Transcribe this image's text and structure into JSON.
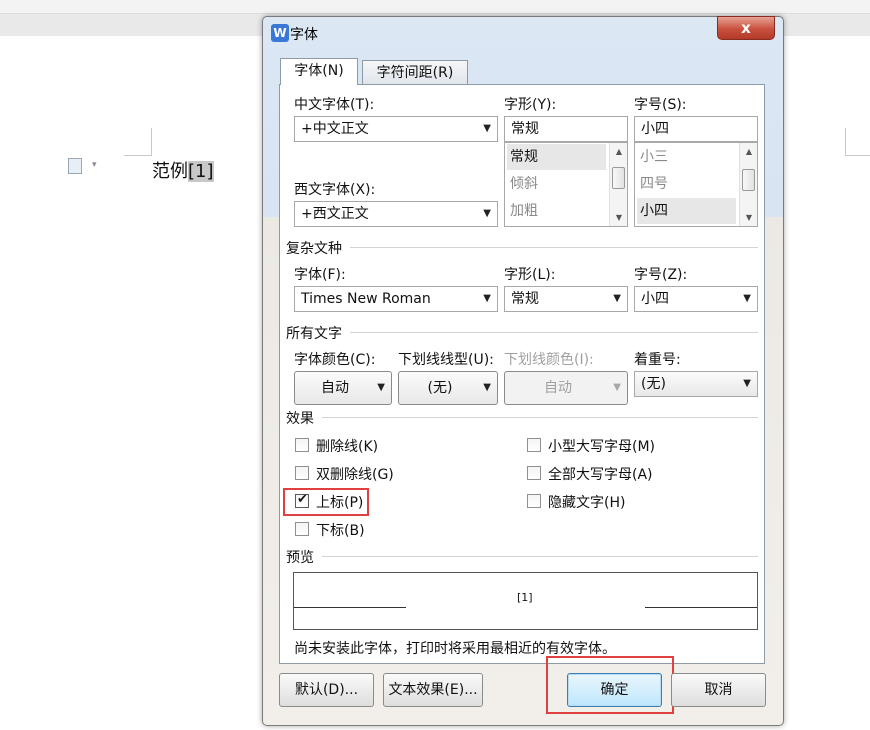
{
  "document": {
    "sample_text": "范例",
    "superscript": "[1]"
  },
  "dialog": {
    "title": "字体",
    "app_icon": "W",
    "close": "x",
    "tabs": [
      {
        "label": "字体(N)",
        "active": true
      },
      {
        "label": "字符间距(R)",
        "active": false
      }
    ],
    "chinese_font": {
      "label": "中文字体(T):",
      "value": "+中文正文"
    },
    "western_font": {
      "label": "西文字体(X):",
      "value": "+西文正文"
    },
    "style": {
      "label": "字形(Y):",
      "value": "常规",
      "options": [
        "常规",
        "倾斜",
        "加粗"
      ],
      "selected": "常规"
    },
    "size": {
      "label": "字号(S):",
      "value": "小四",
      "options": [
        "小三",
        "四号",
        "小四"
      ],
      "selected": "小四"
    },
    "complex": {
      "section": "复杂文种",
      "font_label": "字体(F):",
      "font_value": "Times New Roman",
      "style_label": "字形(L):",
      "style_value": "常规",
      "size_label": "字号(Z):",
      "size_value": "小四"
    },
    "all_text": {
      "section": "所有文字",
      "color_label": "字体颜色(C):",
      "color_value": "自动",
      "underline_label": "下划线线型(U):",
      "underline_value": "(无)",
      "underline_color_label": "下划线颜色(I):",
      "underline_color_value": "自动",
      "emphasis_label": "着重号:",
      "emphasis_value": "(无)"
    },
    "effects": {
      "section": "效果",
      "items": [
        {
          "label": "删除线(K)",
          "checked": false
        },
        {
          "label": "双删除线(G)",
          "checked": false
        },
        {
          "label": "上标(P)",
          "checked": true
        },
        {
          "label": "下标(B)",
          "checked": false
        },
        {
          "label": "小型大写字母(M)",
          "checked": false
        },
        {
          "label": "全部大写字母(A)",
          "checked": false
        },
        {
          "label": "隐藏文字(H)",
          "checked": false
        }
      ]
    },
    "preview": {
      "section": "预览",
      "sample": "[1]",
      "note": "尚未安装此字体，打印时将采用最相近的有效字体。"
    },
    "buttons": {
      "default": "默认(D)...",
      "text_effects": "文本效果(E)...",
      "ok": "确定",
      "cancel": "取消"
    }
  },
  "colors": {
    "highlight_border": "#e04040",
    "title_close_red": "#c9503d",
    "default_button_blue": "#bee6fd"
  }
}
